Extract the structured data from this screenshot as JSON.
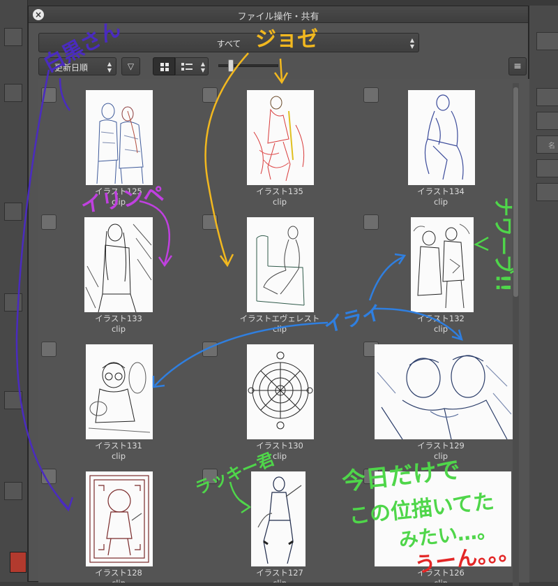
{
  "window": {
    "title": "ファイル操作・共有"
  },
  "toolbar": {
    "filter_value": "すべて",
    "sort_value": "更新日順",
    "sort_direction_icon": "▽",
    "menu_icon": "≡"
  },
  "side_panel": {
    "label": "名"
  },
  "files": [
    {
      "name": "イラスト125",
      "ext": "clip"
    },
    {
      "name": "イラスト135",
      "ext": "clip"
    },
    {
      "name": "イラスト134",
      "ext": "clip"
    },
    {
      "name": "イラスト133",
      "ext": "clip"
    },
    {
      "name": "イラストエヴェレスト",
      "ext": "clip"
    },
    {
      "name": "イラスト132",
      "ext": "clip"
    },
    {
      "name": "イラスト131",
      "ext": "clip"
    },
    {
      "name": "イラスト130",
      "ext": "clip"
    },
    {
      "name": "イラスト129",
      "ext": "clip"
    },
    {
      "name": "イラスト128",
      "ext": "clip"
    },
    {
      "name": "イラスト127",
      "ext": "clip"
    },
    {
      "name": "イラスト126",
      "ext": "clip"
    }
  ],
  "annotations": {
    "purple": "白黒さん",
    "yellow": "ジョゼ",
    "violet": "イリンペ",
    "green_right": "ナワーブ!!",
    "blue": "イライ",
    "green_left": "ラッキー君",
    "green_big_1": "今日だけで",
    "green_big_2": "この位描いてた",
    "green_big_3": "みたい…。",
    "red": "うーん。。。"
  },
  "colors": {
    "purple": "#4a2bbf",
    "yellow": "#f2b81f",
    "violet": "#c040e0",
    "green": "#4fd64a",
    "blue": "#2f7fe0",
    "red": "#e32626"
  }
}
